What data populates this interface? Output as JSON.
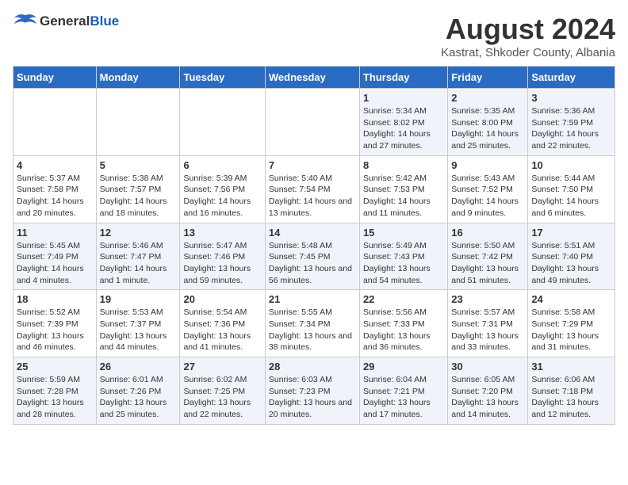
{
  "logo": {
    "general": "General",
    "blue": "Blue"
  },
  "header": {
    "month": "August 2024",
    "location": "Kastrat, Shkoder County, Albania"
  },
  "weekdays": [
    "Sunday",
    "Monday",
    "Tuesday",
    "Wednesday",
    "Thursday",
    "Friday",
    "Saturday"
  ],
  "weeks": [
    [
      {
        "day": "",
        "info": ""
      },
      {
        "day": "",
        "info": ""
      },
      {
        "day": "",
        "info": ""
      },
      {
        "day": "",
        "info": ""
      },
      {
        "day": "1",
        "info": "Sunrise: 5:34 AM\nSunset: 8:02 PM\nDaylight: 14 hours and 27 minutes."
      },
      {
        "day": "2",
        "info": "Sunrise: 5:35 AM\nSunset: 8:00 PM\nDaylight: 14 hours and 25 minutes."
      },
      {
        "day": "3",
        "info": "Sunrise: 5:36 AM\nSunset: 7:59 PM\nDaylight: 14 hours and 22 minutes."
      }
    ],
    [
      {
        "day": "4",
        "info": "Sunrise: 5:37 AM\nSunset: 7:58 PM\nDaylight: 14 hours and 20 minutes."
      },
      {
        "day": "5",
        "info": "Sunrise: 5:38 AM\nSunset: 7:57 PM\nDaylight: 14 hours and 18 minutes."
      },
      {
        "day": "6",
        "info": "Sunrise: 5:39 AM\nSunset: 7:56 PM\nDaylight: 14 hours and 16 minutes."
      },
      {
        "day": "7",
        "info": "Sunrise: 5:40 AM\nSunset: 7:54 PM\nDaylight: 14 hours and 13 minutes."
      },
      {
        "day": "8",
        "info": "Sunrise: 5:42 AM\nSunset: 7:53 PM\nDaylight: 14 hours and 11 minutes."
      },
      {
        "day": "9",
        "info": "Sunrise: 5:43 AM\nSunset: 7:52 PM\nDaylight: 14 hours and 9 minutes."
      },
      {
        "day": "10",
        "info": "Sunrise: 5:44 AM\nSunset: 7:50 PM\nDaylight: 14 hours and 6 minutes."
      }
    ],
    [
      {
        "day": "11",
        "info": "Sunrise: 5:45 AM\nSunset: 7:49 PM\nDaylight: 14 hours and 4 minutes."
      },
      {
        "day": "12",
        "info": "Sunrise: 5:46 AM\nSunset: 7:47 PM\nDaylight: 14 hours and 1 minute."
      },
      {
        "day": "13",
        "info": "Sunrise: 5:47 AM\nSunset: 7:46 PM\nDaylight: 13 hours and 59 minutes."
      },
      {
        "day": "14",
        "info": "Sunrise: 5:48 AM\nSunset: 7:45 PM\nDaylight: 13 hours and 56 minutes."
      },
      {
        "day": "15",
        "info": "Sunrise: 5:49 AM\nSunset: 7:43 PM\nDaylight: 13 hours and 54 minutes."
      },
      {
        "day": "16",
        "info": "Sunrise: 5:50 AM\nSunset: 7:42 PM\nDaylight: 13 hours and 51 minutes."
      },
      {
        "day": "17",
        "info": "Sunrise: 5:51 AM\nSunset: 7:40 PM\nDaylight: 13 hours and 49 minutes."
      }
    ],
    [
      {
        "day": "18",
        "info": "Sunrise: 5:52 AM\nSunset: 7:39 PM\nDaylight: 13 hours and 46 minutes."
      },
      {
        "day": "19",
        "info": "Sunrise: 5:53 AM\nSunset: 7:37 PM\nDaylight: 13 hours and 44 minutes."
      },
      {
        "day": "20",
        "info": "Sunrise: 5:54 AM\nSunset: 7:36 PM\nDaylight: 13 hours and 41 minutes."
      },
      {
        "day": "21",
        "info": "Sunrise: 5:55 AM\nSunset: 7:34 PM\nDaylight: 13 hours and 38 minutes."
      },
      {
        "day": "22",
        "info": "Sunrise: 5:56 AM\nSunset: 7:33 PM\nDaylight: 13 hours and 36 minutes."
      },
      {
        "day": "23",
        "info": "Sunrise: 5:57 AM\nSunset: 7:31 PM\nDaylight: 13 hours and 33 minutes."
      },
      {
        "day": "24",
        "info": "Sunrise: 5:58 AM\nSunset: 7:29 PM\nDaylight: 13 hours and 31 minutes."
      }
    ],
    [
      {
        "day": "25",
        "info": "Sunrise: 5:59 AM\nSunset: 7:28 PM\nDaylight: 13 hours and 28 minutes."
      },
      {
        "day": "26",
        "info": "Sunrise: 6:01 AM\nSunset: 7:26 PM\nDaylight: 13 hours and 25 minutes."
      },
      {
        "day": "27",
        "info": "Sunrise: 6:02 AM\nSunset: 7:25 PM\nDaylight: 13 hours and 22 minutes."
      },
      {
        "day": "28",
        "info": "Sunrise: 6:03 AM\nSunset: 7:23 PM\nDaylight: 13 hours and 20 minutes."
      },
      {
        "day": "29",
        "info": "Sunrise: 6:04 AM\nSunset: 7:21 PM\nDaylight: 13 hours and 17 minutes."
      },
      {
        "day": "30",
        "info": "Sunrise: 6:05 AM\nSunset: 7:20 PM\nDaylight: 13 hours and 14 minutes."
      },
      {
        "day": "31",
        "info": "Sunrise: 6:06 AM\nSunset: 7:18 PM\nDaylight: 13 hours and 12 minutes."
      }
    ]
  ]
}
